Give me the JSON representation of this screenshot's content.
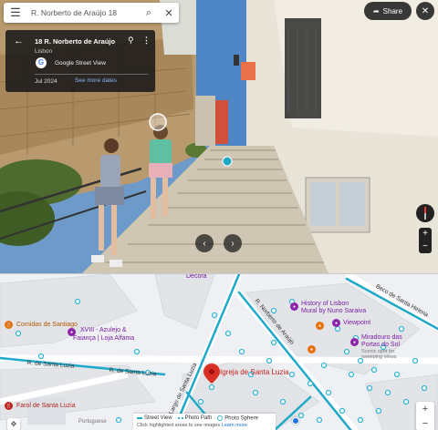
{
  "search": {
    "query": "R. Norberto de Araújo 18",
    "menu_icon": "menu-icon",
    "search_icon": "search-icon",
    "close_icon": "close-icon"
  },
  "info_card": {
    "title": "18 R. Norberto de Araújo",
    "city": "Lisbon",
    "provider": "Google Street View",
    "date": "Jul 2024",
    "see_more": "See more dates"
  },
  "street_view": {
    "share_label": "Share",
    "share_icon": "share-icon",
    "close_icon": "close-icon",
    "zoom_in": "+",
    "zoom_out": "−"
  },
  "map": {
    "pois": [
      {
        "label": "Comidas de Santiago",
        "color": "#e8710a"
      },
      {
        "label": "XVIII - Azulejo &",
        "color": "#8e24aa"
      },
      {
        "label": "Faiança | Loja Alfama",
        "color": "#8e24aa"
      },
      {
        "label": "History of Lisbon",
        "color": "#8e24aa"
      },
      {
        "label": "Mural by Nuno Saraiva",
        "color": "#8e24aa"
      },
      {
        "label": "Viewpoint",
        "color": "#8e24aa"
      },
      {
        "label": "Miradouro das",
        "color": "#8e24aa"
      },
      {
        "label": "Portas do Sol",
        "color": "#8e24aa"
      },
      {
        "label": "Scenic spot for",
        "color": "#8e24aa"
      },
      {
        "label": "sweeping views",
        "color": "#8e24aa"
      },
      {
        "label": "Farol de Santa Luzia",
        "color": "#c5221f"
      },
      {
        "label": "Portuguese",
        "color": "#777"
      },
      {
        "label": "Decora",
        "color": "#8e24aa"
      }
    ],
    "streets": [
      "R. de Santa Luzia",
      "R. de Santa Luzia",
      "Largo de Santa Luzia",
      "R. Norberto de Araújo",
      "Beco de Santa Helena",
      "Decora"
    ],
    "selected_place": "Igreja de Santa Luzia",
    "legend": {
      "street_view": "Street View",
      "photo_path": "Photo Path",
      "photo_sphere": "Photo Sphere",
      "hint": "Click highlighted areas to see images",
      "learn_more": "Learn more"
    },
    "zoom_in": "+",
    "zoom_out": "−",
    "colors": {
      "street_view_line": "#1fa9c9",
      "photo_dot": "#36b6d3",
      "pin": "#d93025"
    }
  }
}
